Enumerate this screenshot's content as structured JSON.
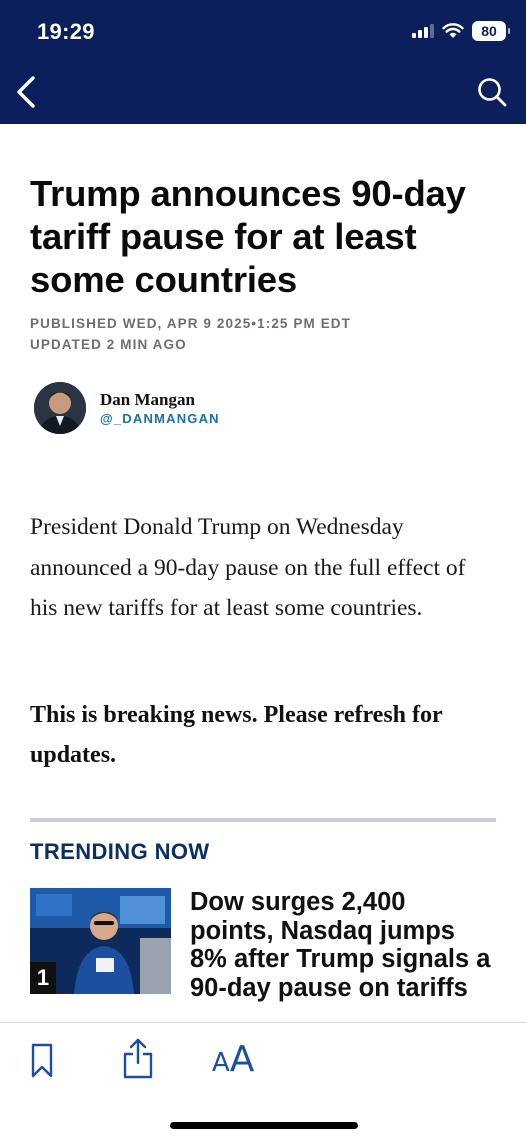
{
  "status_bar": {
    "time": "19:29",
    "battery": "80"
  },
  "nav": {
    "back_icon": "chevron-left-icon",
    "search_icon": "search-icon",
    "bar_color": "#0a1f5c"
  },
  "article": {
    "headline": "Trump announces 90-day tariff pause for at least some countries",
    "published": "PUBLISHED WED, APR 9 2025•1:25 PM EDT",
    "updated": "UPDATED 2 MIN AGO",
    "author": {
      "name": "Dan Mangan",
      "handle": "@_DANMANGAN"
    },
    "body": "President Donald Trump on Wednesday announced a 90-day pause on the full effect of his new tariffs for at least some countries.",
    "breaking": "This is breaking news. Please refresh for updates."
  },
  "trending": {
    "title": "TRENDING NOW",
    "items": [
      {
        "rank": "1",
        "headline": "Dow surges 2,400 points, Nasdaq jumps 8% after Trump signals a 90-day pause on tariffs"
      }
    ]
  },
  "toolbar": {
    "bookmark_icon": "bookmark-icon",
    "share_icon": "share-icon",
    "text_size_small": "A",
    "text_size_big": "A"
  }
}
